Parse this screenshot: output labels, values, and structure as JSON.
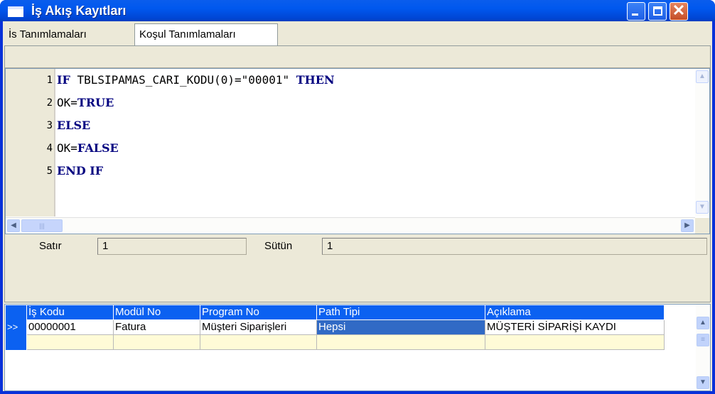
{
  "window": {
    "title": "İş Akış Kayıtları",
    "buttons": {
      "minimize": "_",
      "maximize": "□",
      "close": "✕"
    }
  },
  "tabs": [
    {
      "label": "İs Tanımlamaları",
      "active": false
    },
    {
      "label": "Koşul Tanımlamaları",
      "active": true
    }
  ],
  "editor": {
    "line_numbers": [
      "1",
      "2",
      "3",
      "4",
      "5"
    ],
    "lines": [
      [
        {
          "t": "IF",
          "kw": true
        },
        {
          "t": " TBLSIPAMAS_CARI_KODU(0)=\"00001\" "
        },
        {
          "t": "THEN",
          "kw": true
        }
      ],
      [
        {
          "t": "OK="
        },
        {
          "t": "TRUE",
          "kw": true
        }
      ],
      [
        {
          "t": "ELSE",
          "kw": true
        }
      ],
      [
        {
          "t": "OK="
        },
        {
          "t": "FALSE",
          "kw": true
        }
      ],
      [
        {
          "t": "END IF",
          "kw": true
        }
      ]
    ]
  },
  "status": {
    "row_label": "Satır",
    "row_value": "1",
    "col_label": "Sütün",
    "col_value": "1"
  },
  "grid": {
    "columns": [
      "İş Kodu",
      "Modül No",
      "Program No",
      "Path Tipi",
      "Açıklama"
    ],
    "current_row_indicator": ">>",
    "rows": [
      [
        "00000001",
        "Fatura",
        "Müşteri Siparişleri",
        "Hepsi",
        "MÜŞTERİ SİPARİŞİ KAYDI"
      ]
    ]
  },
  "colors": {
    "title_bar": "#0058ee",
    "grid_header": "#0b61f1",
    "selection": "#316ac5",
    "keyword": "#000080",
    "new_row": "#fffbd7"
  }
}
